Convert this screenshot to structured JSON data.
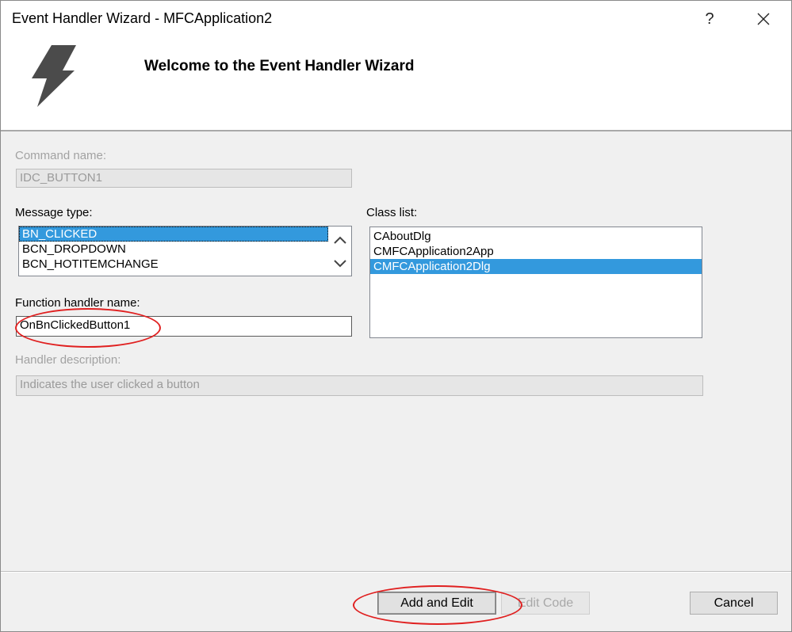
{
  "window": {
    "title": "Event Handler Wizard - MFCApplication2",
    "help_label": "?",
    "close_label": "✕"
  },
  "banner": {
    "heading": "Welcome to the Event Handler Wizard",
    "icon": "lightning-bolt-icon"
  },
  "form": {
    "command_name_label": "Command name:",
    "command_name_value": "IDC_BUTTON1",
    "message_type_label": "Message type:",
    "message_types": [
      "BN_CLICKED",
      "BCN_DROPDOWN",
      "BCN_HOTITEMCHANGE"
    ],
    "message_type_selected": "BN_CLICKED",
    "class_list_label": "Class list:",
    "classes": [
      "CAboutDlg",
      "CMFCApplication2App",
      "CMFCApplication2Dlg"
    ],
    "class_selected": "CMFCApplication2Dlg",
    "function_handler_label": "Function handler name:",
    "function_handler_value": "OnBnClickedButton1",
    "handler_description_label": "Handler description:",
    "handler_description_value": "Indicates the user clicked a button"
  },
  "buttons": {
    "add_and_edit": "Add and Edit",
    "edit_code": "Edit Code",
    "cancel": "Cancel"
  },
  "colors": {
    "selection": "#3399dd",
    "annotation": "#e02020"
  }
}
